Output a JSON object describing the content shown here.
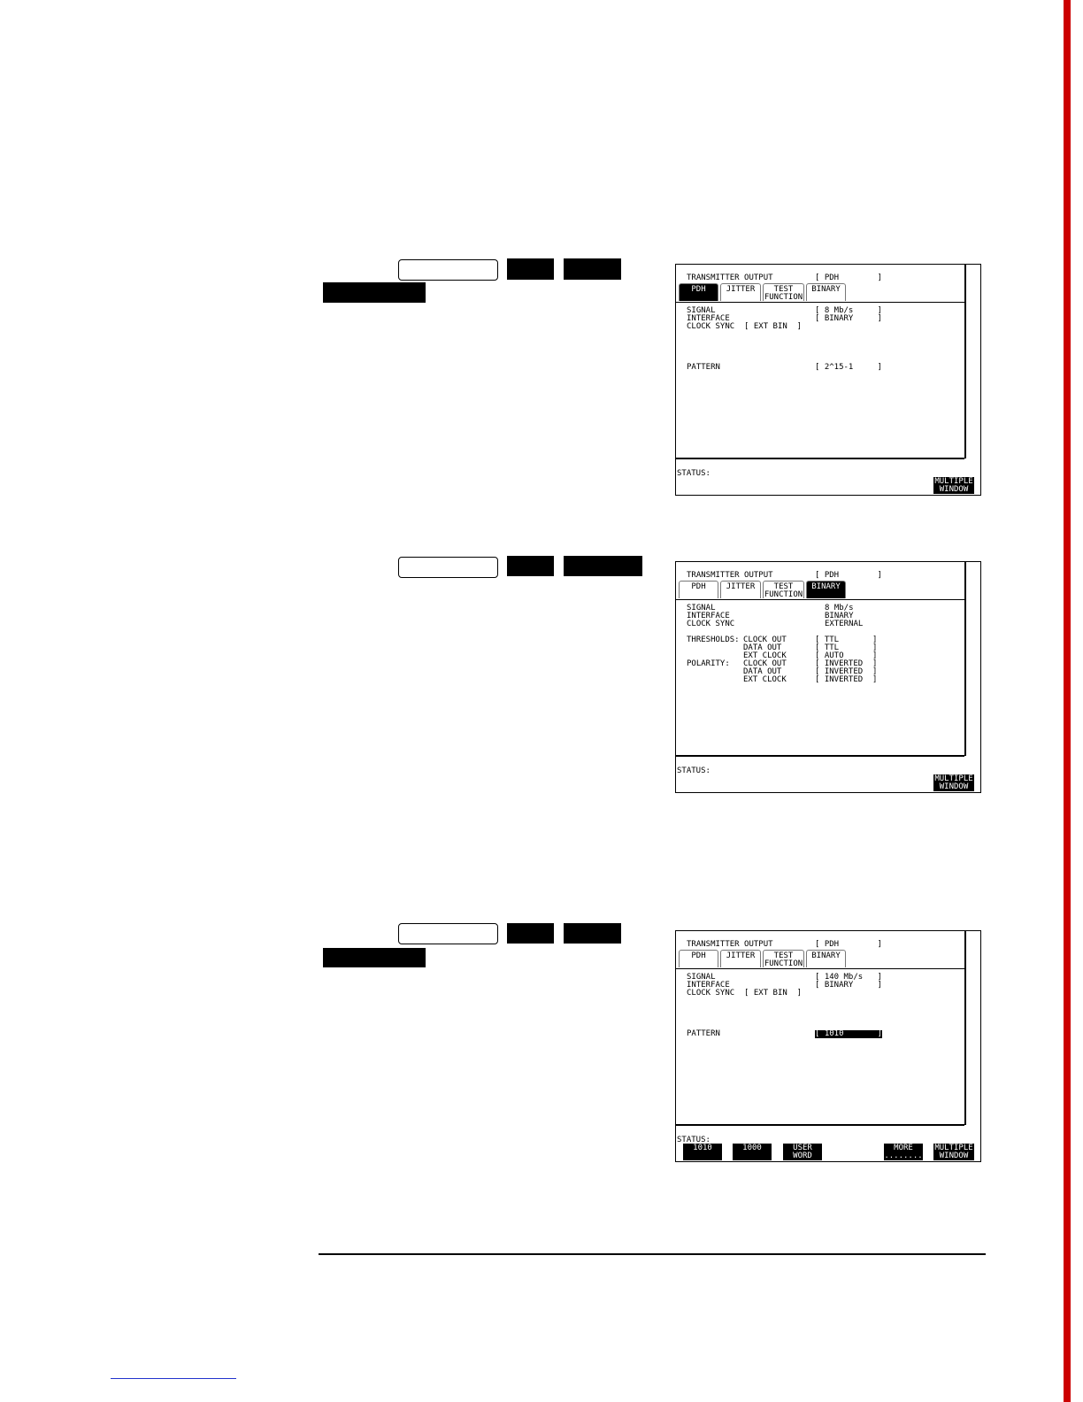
{
  "colors": {
    "accent_bar": "#cc0000",
    "link_rule": "#2233cc"
  },
  "screens": [
    {
      "title_label": "TRANSMITTER OUTPUT",
      "title_value": "[ PDH        ]",
      "tabs": [
        {
          "line1": "PDH",
          "line2": "",
          "active": true
        },
        {
          "line1": "JITTER",
          "line2": "",
          "active": false
        },
        {
          "line1": "TEST",
          "line2": "FUNCTION",
          "active": false
        },
        {
          "line1": "BINARY",
          "line2": "",
          "active": false
        }
      ],
      "rows": [
        {
          "label": "SIGNAL",
          "value": "[ 8 Mb/s     ]"
        },
        {
          "label": "INTERFACE",
          "value": "[ BINARY     ]"
        },
        {
          "label": "CLOCK SYNC  [ EXT BIN  ]",
          "value": ""
        },
        {
          "label": "PATTERN",
          "value": "[ 2^15-1     ]"
        }
      ],
      "status_label": "STATUS:",
      "softkeys": [
        {
          "line1": "MULTIPLE",
          "line2": "WINDOW"
        }
      ]
    },
    {
      "title_label": "TRANSMITTER OUTPUT",
      "title_value": "[ PDH        ]",
      "tabs": [
        {
          "line1": "PDH",
          "line2": "",
          "active": false
        },
        {
          "line1": "JITTER",
          "line2": "",
          "active": false
        },
        {
          "line1": "TEST",
          "line2": "FUNCTION",
          "active": false
        },
        {
          "line1": "BINARY",
          "line2": "",
          "active": true
        }
      ],
      "rows": [
        {
          "label": "SIGNAL",
          "value": "8 Mb/s"
        },
        {
          "label": "INTERFACE",
          "value": "BINARY"
        },
        {
          "label": "CLOCK SYNC",
          "value": "EXTERNAL"
        }
      ],
      "thresholds": {
        "label": "THRESHOLDS:",
        "items": [
          {
            "name": "CLOCK OUT",
            "value": "[ TTL       ]"
          },
          {
            "name": "DATA OUT",
            "value": "[ TTL       ]"
          },
          {
            "name": "EXT CLOCK",
            "value": "[ AUTO      ]"
          }
        ]
      },
      "polarity": {
        "label": "POLARITY:",
        "items": [
          {
            "name": "CLOCK OUT",
            "value": "[ INVERTED  ]"
          },
          {
            "name": "DATA OUT",
            "value": "[ INVERTED  ]"
          },
          {
            "name": "EXT CLOCK",
            "value": "[ INVERTED  ]"
          }
        ]
      },
      "status_label": "STATUS:",
      "softkeys": [
        {
          "line1": "MULTIPLE",
          "line2": "WINDOW"
        }
      ]
    },
    {
      "title_label": "TRANSMITTER OUTPUT",
      "title_value": "[ PDH        ]",
      "tabs": [
        {
          "line1": "PDH",
          "line2": "",
          "active": false
        },
        {
          "line1": "JITTER",
          "line2": "",
          "active": false
        },
        {
          "line1": "TEST",
          "line2": "FUNCTION",
          "active": false
        },
        {
          "line1": "BINARY",
          "line2": "",
          "active": false
        }
      ],
      "rows": [
        {
          "label": "SIGNAL",
          "value": "[ 140 Mb/s   ]"
        },
        {
          "label": "INTERFACE",
          "value": "[ BINARY     ]"
        },
        {
          "label": "CLOCK SYNC  [ EXT BIN  ]",
          "value": ""
        },
        {
          "label": "PATTERN",
          "value": "[ 1010       ]"
        }
      ],
      "status_label": "STATUS:",
      "softkeys": [
        {
          "line1": "1010",
          "line2": ""
        },
        {
          "line1": "1000",
          "line2": ""
        },
        {
          "line1": "USER",
          "line2": "WORD"
        },
        {
          "line1": "MORE",
          "line2": "........"
        },
        {
          "line1": "MULTIPLE",
          "line2": "WINDOW"
        }
      ]
    }
  ]
}
